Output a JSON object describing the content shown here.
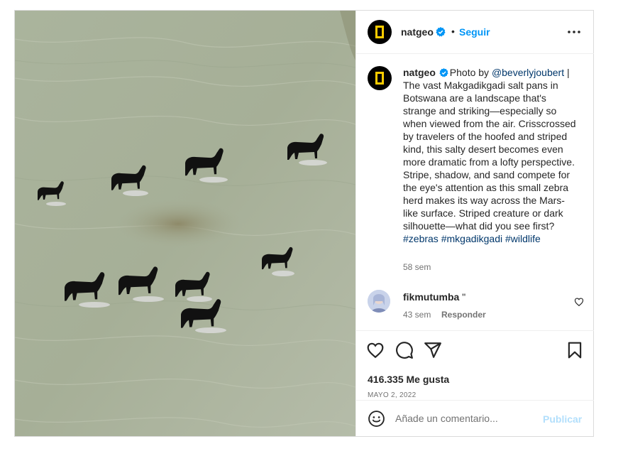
{
  "post": {
    "image": {
      "subject": "aerial photo of a zebra herd crossing a salt pan"
    },
    "header": {
      "username": "natgeo",
      "dot": "•",
      "follow_label": "Seguir",
      "avatar_icon": "natgeo-logo-icon",
      "verified_icon": "verified-badge-icon",
      "more_icon": "more-options-icon"
    },
    "caption": {
      "username": "natgeo",
      "intro": "Photo by ",
      "mention": "@beverlyjoubert",
      "body": " | The vast Makgadikgadi salt pans in Botswana are a landscape that's strange and striking—especially so when viewed from the air. Crisscrossed by travelers of the hoofed and striped kind, this salty desert becomes even more dramatic from a lofty perspective. Stripe, shadow, and sand compete for the eye's attention as this small zebra herd makes its way across the Mars-like surface. Striped creature or dark silhouette—what did you see first? ",
      "hashtags": [
        "#zebras",
        "#mkgadikgadi",
        "#wildlife"
      ],
      "time": "58 sem"
    },
    "comment": {
      "username": "fikmutumba",
      "text": " \"",
      "time": "43 sem",
      "reply_label": "Responder",
      "like_icon": "heart-outline-icon"
    },
    "actions": {
      "icons": [
        "heart-icon",
        "comment-icon",
        "share-icon",
        "bookmark-icon"
      ],
      "likes": "416.335 Me gusta",
      "date": "MAYO 2, 2022"
    },
    "add_comment": {
      "placeholder": "Añade un comentario...",
      "publish_label": "Publicar",
      "emoji_icon": "emoji-icon"
    },
    "colors": {
      "accent": "#0095f6",
      "link": "#00376b",
      "muted": "#737373",
      "publish_disabled": "#b2dffc",
      "brand_yellow": "#ffcc00"
    }
  }
}
